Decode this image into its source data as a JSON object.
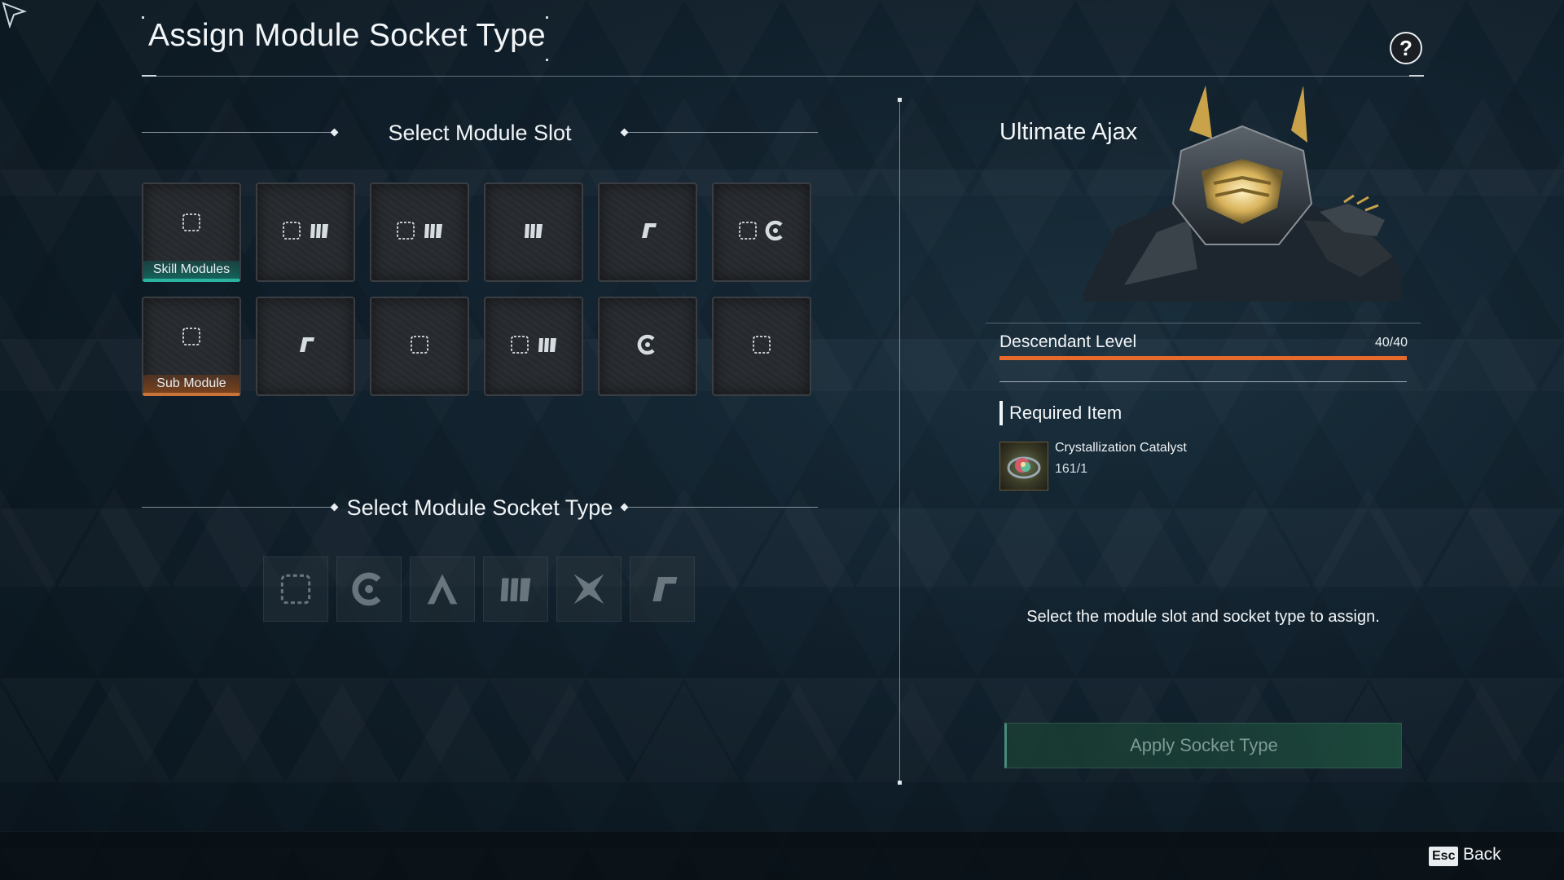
{
  "header": {
    "title": "Assign Module Socket Type",
    "help_label": "?"
  },
  "slot_section": {
    "title": "Select Module Slot"
  },
  "slots": [
    {
      "label": "Skill Modules",
      "icons": [
        "empty-socket-icon"
      ],
      "type": "skill"
    },
    {
      "label": "",
      "icons": [
        "empty-socket-icon",
        "rutile-socket-icon"
      ]
    },
    {
      "label": "",
      "icons": [
        "empty-socket-icon",
        "rutile-socket-icon"
      ]
    },
    {
      "label": "",
      "icons": [
        "rutile-socket-icon"
      ]
    },
    {
      "label": "",
      "icons": [
        "xantic-socket-icon"
      ]
    },
    {
      "label": "",
      "icons": [
        "empty-socket-icon",
        "cerulean-socket-icon"
      ]
    },
    {
      "label": "Sub Module",
      "icons": [
        "empty-socket-icon"
      ],
      "type": "sub"
    },
    {
      "label": "",
      "icons": [
        "xantic-socket-icon"
      ]
    },
    {
      "label": "",
      "icons": [
        "empty-socket-icon"
      ]
    },
    {
      "label": "",
      "icons": [
        "empty-socket-icon",
        "rutile-socket-icon"
      ]
    },
    {
      "label": "",
      "icons": [
        "cerulean-socket-icon"
      ]
    },
    {
      "label": "",
      "icons": [
        "empty-socket-icon"
      ]
    }
  ],
  "socket_section": {
    "title": "Select Module Socket Type"
  },
  "socket_types": [
    "empty-socket-icon",
    "cerulean-socket-icon",
    "almandine-socket-icon",
    "rutile-socket-icon",
    "malachite-socket-icon",
    "xantic-socket-icon"
  ],
  "character": {
    "name": "Ultimate Ajax"
  },
  "level": {
    "label": "Descendant Level",
    "value": "40/40",
    "fraction": 1.0
  },
  "required": {
    "title": "Required Item",
    "item_name": "Crystallization Catalyst",
    "item_count": "161/1"
  },
  "hint": "Select the module slot and socket type to assign.",
  "apply_button": "Apply Socket Type",
  "footer": {
    "esc_key": "Esc",
    "back_label": "Back"
  },
  "colors": {
    "skill_accent": "#2bb3a0",
    "sub_accent": "#c7733a",
    "level_bar": "#e66a2c"
  }
}
